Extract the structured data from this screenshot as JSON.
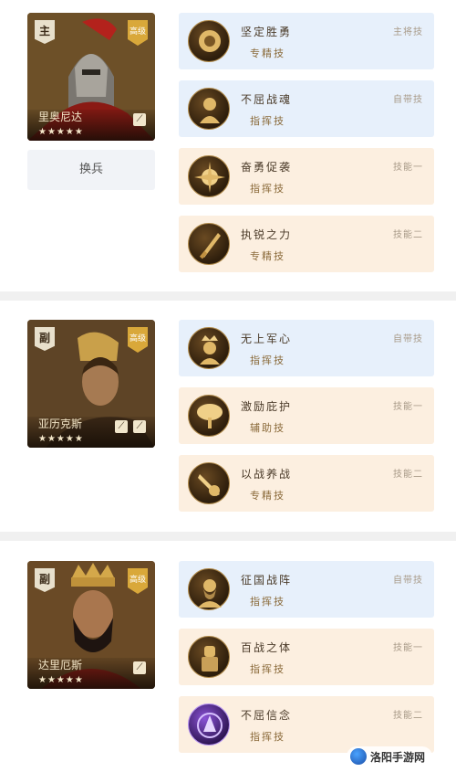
{
  "groups": [
    {
      "hero": {
        "role_badge": "主",
        "name": "里奥尼达",
        "stars": "★★★★★",
        "shield_text": "高级"
      },
      "replace_label": "换兵",
      "skills": [
        {
          "name": "坚定胜勇",
          "type": "专精技",
          "slot": "主将技",
          "bg": "blue"
        },
        {
          "name": "不屈战魂",
          "type": "指挥技",
          "slot": "自带技",
          "bg": "blue"
        },
        {
          "name": "奋勇促袭",
          "type": "指挥技",
          "slot": "技能一",
          "bg": "peach"
        },
        {
          "name": "执锐之力",
          "type": "专精技",
          "slot": "技能二",
          "bg": "peach"
        }
      ]
    },
    {
      "hero": {
        "role_badge": "副",
        "name": "亚历克斯",
        "stars": "★★★★★",
        "shield_text": "高级"
      },
      "skills": [
        {
          "name": "无上军心",
          "type": "指挥技",
          "slot": "自带技",
          "bg": "blue"
        },
        {
          "name": "激励庇护",
          "type": "辅助技",
          "slot": "技能一",
          "bg": "peach"
        },
        {
          "name": "以战养战",
          "type": "专精技",
          "slot": "技能二",
          "bg": "peach"
        }
      ]
    },
    {
      "hero": {
        "role_badge": "副",
        "name": "达里厄斯",
        "stars": "★★★★★",
        "shield_text": "高级"
      },
      "skills": [
        {
          "name": "征国战阵",
          "type": "指挥技",
          "slot": "自带技",
          "bg": "blue"
        },
        {
          "name": "百战之体",
          "type": "指挥技",
          "slot": "技能一",
          "bg": "peach"
        },
        {
          "name": "不屈信念",
          "type": "指挥技",
          "slot": "技能二",
          "bg": "peach"
        }
      ]
    }
  ],
  "watermark": {
    "text": "洛阳手游网"
  }
}
